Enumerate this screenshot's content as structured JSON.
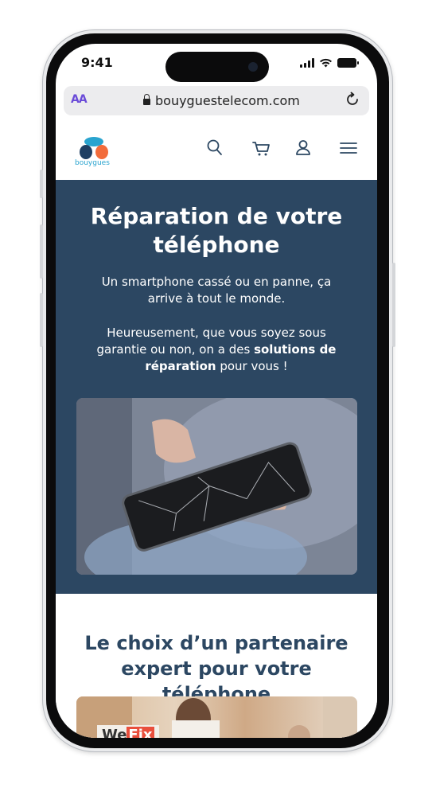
{
  "status_bar": {
    "time": "9:41"
  },
  "browser": {
    "text_size_label": "AA",
    "url": "bouyguestelecom.com"
  },
  "site": {
    "brand": "bouygues",
    "nav": [
      "search",
      "cart",
      "account",
      "menu"
    ]
  },
  "hero": {
    "title": "Réparation de votre téléphone",
    "intro": "Un smartphone cassé ou en panne, ça arrive à tout le monde.",
    "body_before": "Heureusement, que vous soyez sous garantie ou non, on a des ",
    "body_bold": "solutions de réparation",
    "body_after": " pour vous !",
    "image_alt": "Hand holding a smartphone with a cracked screen"
  },
  "partner": {
    "title": "Le choix d’un partenaire expert pour votre téléphone",
    "logo_part1": "We",
    "logo_part2": "Fix"
  },
  "colors": {
    "hero_bg": "#2c4762",
    "accent_purple": "#6a4bd8",
    "brand_blue": "#2aa4cf",
    "brand_orange": "#f26c3b"
  }
}
